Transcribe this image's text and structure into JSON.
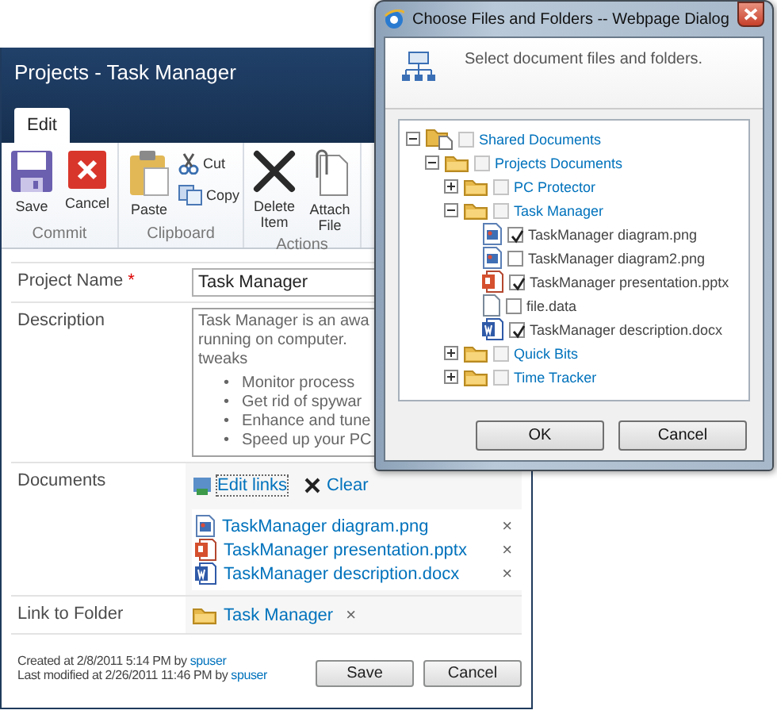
{
  "page": {
    "title": "Projects - Task Manager",
    "tabs": [
      {
        "label": "Edit",
        "selected": true
      }
    ]
  },
  "ribbon": {
    "groups": [
      {
        "label": "Commit",
        "buttons": [
          {
            "kind": "save",
            "label": "Save"
          },
          {
            "kind": "cancel",
            "label": "Cancel"
          }
        ]
      },
      {
        "label": "Clipboard",
        "buttons": [
          {
            "kind": "paste",
            "label": "Paste"
          }
        ],
        "small_buttons": [
          {
            "kind": "cut",
            "label": "Cut"
          },
          {
            "kind": "copy",
            "label": "Copy"
          }
        ]
      },
      {
        "label": "Actions",
        "buttons": [
          {
            "kind": "delete",
            "label": "Delete Item"
          },
          {
            "kind": "attach",
            "label": "Attach File"
          }
        ]
      }
    ]
  },
  "form": {
    "project_name": {
      "label": "Project Name",
      "required_mark": "*",
      "value": "Task Manager"
    },
    "description": {
      "label": "Description",
      "lines": [
        "Task Manager is an awa",
        "running on computer.",
        "tweaks"
      ],
      "bullet_mark": "•",
      "bullets": [
        "Monitor process",
        "Get rid of spywar",
        "Enhance and tune",
        "Speed up your PC"
      ]
    },
    "documents": {
      "label": "Documents",
      "edit_links": "Edit links",
      "clear": "Clear",
      "files": [
        {
          "kind": "image",
          "name": "TaskManager diagram.png",
          "remove": "×"
        },
        {
          "kind": "powerpoint",
          "name": "TaskManager presentation.pptx",
          "remove": "×"
        },
        {
          "kind": "word",
          "name": "TaskManager description.docx",
          "remove": "×"
        }
      ]
    },
    "link_to_folder": {
      "label": "Link to Folder",
      "folder": "Task Manager",
      "remove": "×"
    }
  },
  "footer": {
    "created": {
      "text": "Created at 2/8/2011 5:14 PM by",
      "user": "spuser"
    },
    "modified": {
      "text": "Last modified at 2/26/2011 11:46 PM by",
      "user": "spuser"
    },
    "buttons": [
      "Save",
      "Cancel"
    ]
  },
  "dialog": {
    "title": "Choose Files and Folders -- Webpage Dialog",
    "instruction": "Select document files and folders.",
    "tree": [
      {
        "kind": "library",
        "label": "Shared Documents",
        "expanded": true,
        "checked": false,
        "children": [
          {
            "kind": "folder",
            "label": "Projects Documents",
            "expanded": true,
            "checked": false,
            "children": [
              {
                "kind": "folder",
                "label": "PC Protector",
                "expanded": false,
                "checked": false
              },
              {
                "kind": "folder",
                "label": "Task Manager",
                "expanded": true,
                "checked": false,
                "children": [
                  {
                    "kind": "image",
                    "label": "TaskManager diagram.png",
                    "checked": true
                  },
                  {
                    "kind": "image",
                    "label": "TaskManager diagram2.png",
                    "checked": false
                  },
                  {
                    "kind": "powerpoint",
                    "label": "TaskManager presentation.pptx",
                    "checked": true
                  },
                  {
                    "kind": "file",
                    "label": "file.data",
                    "checked": false
                  },
                  {
                    "kind": "word",
                    "label": "TaskManager description.docx",
                    "checked": true
                  }
                ]
              },
              {
                "kind": "folder",
                "label": "Quick Bits",
                "expanded": false,
                "checked": false
              },
              {
                "kind": "folder",
                "label": "Time Tracker",
                "expanded": false,
                "checked": false
              }
            ]
          }
        ]
      }
    ],
    "buttons": [
      "OK",
      "Cancel"
    ]
  }
}
